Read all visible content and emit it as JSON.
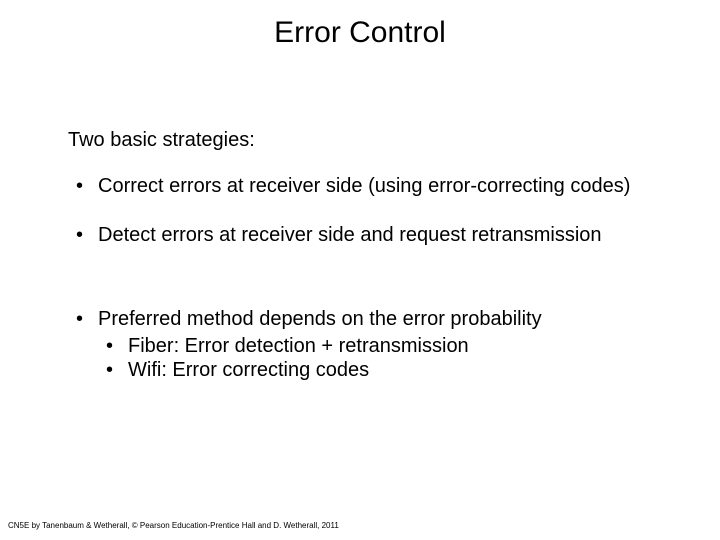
{
  "title": "Error Control",
  "intro": "Two basic strategies:",
  "bullets": {
    "b1": "Correct errors at receiver side (using error-correcting codes)",
    "b2": "Detect errors at receiver side and request retransmission",
    "b3": "Preferred method depends on the error probability",
    "b3a": "Fiber: Error detection + retransmission",
    "b3b": "Wifi: Error correcting codes"
  },
  "footer": "CN5E by Tanenbaum & Wetherall, © Pearson Education-Prentice Hall and D. Wetherall, 2011"
}
